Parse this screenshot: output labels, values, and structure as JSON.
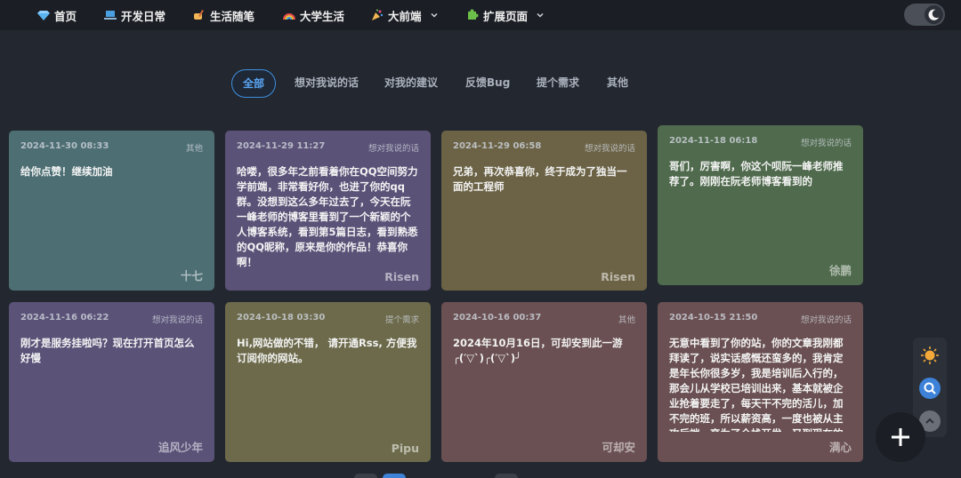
{
  "nav": {
    "items": [
      {
        "label": "首页",
        "icon": "diamond-icon"
      },
      {
        "label": "开发日常",
        "icon": "laptop-icon"
      },
      {
        "label": "生活随笔",
        "icon": "writing-hand-icon"
      },
      {
        "label": "大学生活",
        "icon": "rainbow-icon"
      },
      {
        "label": "大前端",
        "icon": "party-popper-icon"
      },
      {
        "label": "扩展页面",
        "icon": "puzzle-icon"
      }
    ]
  },
  "tabs": [
    {
      "label": "全部",
      "active": true
    },
    {
      "label": "想对我说的话"
    },
    {
      "label": "对我的建议"
    },
    {
      "label": "反馈Bug"
    },
    {
      "label": "提个需求"
    },
    {
      "label": "其他"
    }
  ],
  "cards": [
    {
      "date": "2024-11-30 08:33",
      "tag": "其他",
      "text": "给你点赞！继续加油",
      "author": "十七",
      "color": "#4d6f74"
    },
    {
      "date": "2024-11-29 11:27",
      "tag": "想对我说的话",
      "text": "哈喽，很多年之前看着你在QQ空间努力学前端，非常看好你，也进了你的qq群。没想到这么多年过去了，今天在阮一峰老师的博客里看到了一个新颖的个人博客系统，看到第5篇日志，看到熟悉的QQ昵称，原来是你的作品！恭喜你啊！",
      "author": "Risen",
      "color": "#5b5278"
    },
    {
      "date": "2024-11-29 06:58",
      "tag": "想对我说的话",
      "text": "兄弟，再次恭喜你，终于成为了独当一面的工程师",
      "author": "Risen",
      "color": "#6c6346"
    },
    {
      "date": "2024-11-18 06:18",
      "tag": "想对我说的话",
      "text": "哥们，厉害啊，你这个呗阮一峰老师推荐了。刚刚在阮老师博客看到的",
      "author": "徐鹏",
      "color": "#4f6a4c"
    },
    {
      "date": "2024-11-16 06:22",
      "tag": "想对我说的话",
      "text": "刚才是服务挂啦吗？现在打开首页怎么好慢",
      "author": "追风少年",
      "color": "#5b5278"
    },
    {
      "date": "2024-10-18 03:30",
      "tag": "提个需求",
      "text": "Hi,网站做的不错， 请开通Rss, 方便我订阅你的网站。",
      "author": "Pipu",
      "color": "#6c6a4a"
    },
    {
      "date": "2024-10-16 00:37",
      "tag": "其他",
      "text": "2024年10月16日，可却安到此一游╭(′▽`)╭(′▽`)╯",
      "author": "可却安",
      "color": "#6a5052"
    },
    {
      "date": "2024-10-15 21:50",
      "tag": "想对我说的话",
      "text": "无意中看到了你的站，你的文章我刚都拜读了，说实话感慨还蛮多的，我肯定是年长你很多岁，我是培训后入行的，那会儿从学校已培训出来，基本就被企业抢着要走了，每天干不完的活儿，加不完的班，所以薪资高，一度也被从主攻后端，变为了全栈开发，又到现在的运维开架构，想",
      "author": "满心",
      "color": "#6a5052"
    }
  ],
  "tools": [
    "sun-icon",
    "search-icon",
    "scroll-up-icon"
  ],
  "fab": {
    "icon": "plus-icon"
  }
}
